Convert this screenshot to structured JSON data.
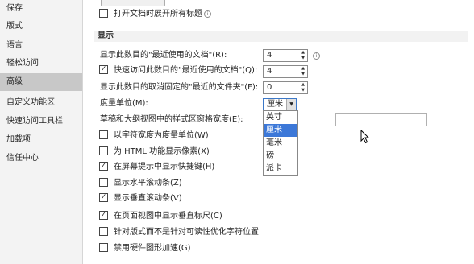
{
  "sidebar": {
    "items": [
      {
        "label": "保存"
      },
      {
        "label": "版式"
      },
      {
        "label": "语言"
      },
      {
        "label": "轻松访问"
      },
      {
        "label": "高级"
      },
      {
        "label": "自定义功能区"
      },
      {
        "label": "快速访问工具栏"
      },
      {
        "label": "加载项"
      },
      {
        "label": "信任中心"
      }
    ],
    "active_index": 4
  },
  "top_options": {
    "expand_headings_label": "打开文档时展开所有标题"
  },
  "display": {
    "header": "显示",
    "recent_docs_label": "显示此数目的\"最近使用的文档\"(R):",
    "recent_docs_value": "4",
    "quick_access_label": "快速访问此数目的\"最近使用的文档\"(Q):",
    "quick_access_value": "4",
    "unpinned_folders_label": "显示此数目的取消固定的\"最近的文件夹\"(F):",
    "unpinned_folders_value": "0",
    "measure_units_label": "度量单位(M):",
    "measure_units_value": "厘米",
    "measure_units_options": [
      "英寸",
      "厘米",
      "毫米",
      "磅",
      "派卡"
    ],
    "style_width_label": "草稿和大纲视图中的样式区窗格宽度(E):",
    "checkboxes": [
      {
        "label": "以字符宽度为度量单位(W)",
        "checked": false
      },
      {
        "label": "为 HTML 功能显示像素(X)",
        "checked": false
      },
      {
        "label": "在屏幕提示中显示快捷键(H)",
        "checked": true
      },
      {
        "label": "显示水平滚动条(Z)",
        "checked": false
      },
      {
        "label": "显示垂直滚动条(V)",
        "checked": true
      },
      {
        "label": "在页面视图中显示垂直标尺(C)",
        "checked": true
      },
      {
        "label": "针对版式而不是针对可读性优化字符位置",
        "checked": false
      },
      {
        "label": "禁用硬件图形加速(G)",
        "checked": false
      }
    ]
  },
  "icons": {
    "info": "i",
    "spin_up": "▲",
    "spin_down": "▼",
    "dropdown_arrow": "▼",
    "check": "✓"
  }
}
